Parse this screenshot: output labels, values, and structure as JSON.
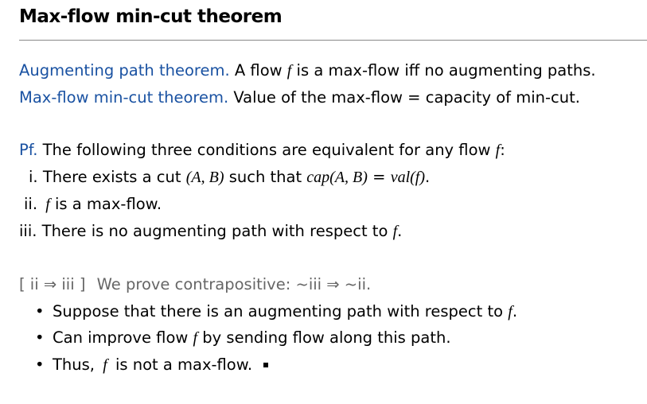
{
  "slide": {
    "title": "Max-flow min-cut theorem"
  },
  "theorems": {
    "augmenting_label": "Augmenting path theorem.",
    "augmenting_text_1": "A flow ",
    "augmenting_var": "f",
    "augmenting_text_2": " is a max-flow iff no augmenting paths.",
    "maxflow_label": "Max-flow min-cut theorem.",
    "maxflow_text": "Value of the max-flow = capacity of min-cut."
  },
  "proof": {
    "pf_label": "Pf.",
    "pf_text": "The following three conditions are equivalent for any flow ",
    "pf_var": "f",
    "pf_end": ":",
    "cond_i_num": "i.",
    "cond_i_text_1": "There exists a cut ",
    "cond_i_cut": "(A, B)",
    "cond_i_text_2": " such that ",
    "cond_i_formula": "cap(A, B)",
    "cond_i_eq": " = ",
    "cond_i_formula_2": "val(f)",
    "cond_i_end": ".",
    "cond_ii_num": "ii.",
    "cond_ii_var": "f",
    "cond_ii_text": " is a max-flow.",
    "cond_iii_num": "iii.",
    "cond_iii_text": "There is no augmenting path with respect to ",
    "cond_iii_var": "f",
    "cond_iii_end": "."
  },
  "contrapositive": {
    "heading_bracket": "[ ii ⇒ iii ]",
    "heading_text": "We prove contrapositive:  ~iii ⇒ ~ii.",
    "bullet_char": "•",
    "b1_text": "Suppose that there is an augmenting path with respect to ",
    "b1_var": "f",
    "b1_end": ".",
    "b2_text_1": "Can improve flow ",
    "b2_var": "f",
    "b2_text_2": " by sending flow along this path.",
    "b3_text_1": "Thus, ",
    "b3_var": "f",
    "b3_text_2": " is not a max-flow."
  }
}
